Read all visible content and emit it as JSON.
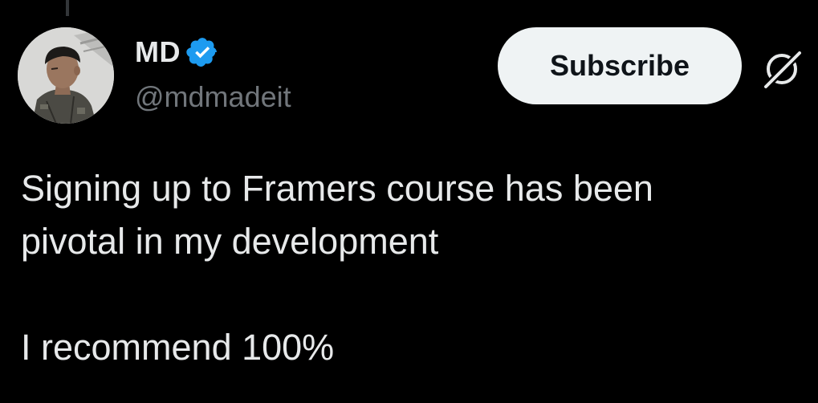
{
  "author": {
    "display_name": "MD",
    "handle": "@mdmadeit",
    "verified": true,
    "verified_icon": "verified-badge-icon"
  },
  "actions": {
    "subscribe_label": "Subscribe",
    "grok_icon": "grok-icon"
  },
  "tweet": {
    "line1": "Signing up to Framers course has been",
    "line2": "pivotal in my development",
    "line3": "I recommend 100%"
  },
  "colors": {
    "background": "#000000",
    "primary_text": "#e7e9ea",
    "secondary_text": "#71767b",
    "verified_blue": "#1d9bf0",
    "button_bg": "#eff3f4",
    "button_text": "#0f1419"
  }
}
